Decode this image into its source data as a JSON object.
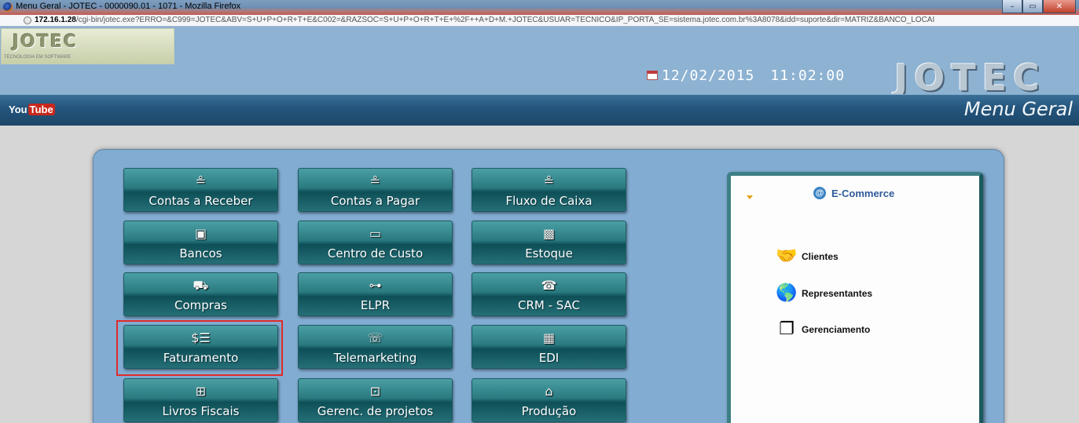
{
  "window": {
    "title": "Menu Geral - JOTEC - 0000090.01 - 1071 - Mozilla Firefox",
    "minimize": "–",
    "maximize": "▭",
    "close": "✕"
  },
  "address": {
    "host": "172.16.1.28",
    "path": "/cgi-bin/jotec.exe?ERRO=&C999=JOTEC&ABV=S+U+P+O+R+T+E&C002=&RAZSOC=S+U+P+O+R+T+E+%2F++A+D+M.+JOTEC&USUAR=TECNICO&IP_PORTA_SE=sistema.jotec.com.br%3A8078&idd=suporte&dir=MATRIZ&BANCO_LOCAI"
  },
  "header": {
    "logo_small_word": "JOTEC",
    "logo_small_tag": "TECNOLOGIA EM SOFTWARE",
    "date": "12/02/2015",
    "time": "11:02:00",
    "logo_big": "JOTEC"
  },
  "nav": {
    "youtube_you": "You",
    "youtube_tube": "Tube",
    "title": "Menu Geral"
  },
  "modules": [
    {
      "label": "Contas a Receber",
      "icon": "≗"
    },
    {
      "label": "Contas a Pagar",
      "icon": "≗"
    },
    {
      "label": "Fluxo de Caixa",
      "icon": "≗"
    },
    {
      "label": "Bancos",
      "icon": "▣"
    },
    {
      "label": "Centro de Custo",
      "icon": "▭"
    },
    {
      "label": "Estoque",
      "icon": "▩"
    },
    {
      "label": "Compras",
      "icon": "⛟"
    },
    {
      "label": "ELPR",
      "icon": "⊶"
    },
    {
      "label": "CRM - SAC",
      "icon": "☎"
    },
    {
      "label": "Faturamento",
      "icon": "$☰"
    },
    {
      "label": "Telemarketing",
      "icon": "☏"
    },
    {
      "label": "EDI",
      "icon": "▦"
    },
    {
      "label": "Livros Fiscais",
      "icon": "⊞"
    },
    {
      "label": "Gerenc. de projetos",
      "icon": "⊡"
    },
    {
      "label": "Produção",
      "icon": "⌂"
    }
  ],
  "ecommerce": {
    "title": "E-Commerce",
    "at_icon": "@",
    "items": [
      {
        "label": "Clientes",
        "icon": "🤝"
      },
      {
        "label": "Representantes",
        "icon": "🌎"
      },
      {
        "label": "Gerenciamento",
        "icon": "❐"
      }
    ]
  }
}
